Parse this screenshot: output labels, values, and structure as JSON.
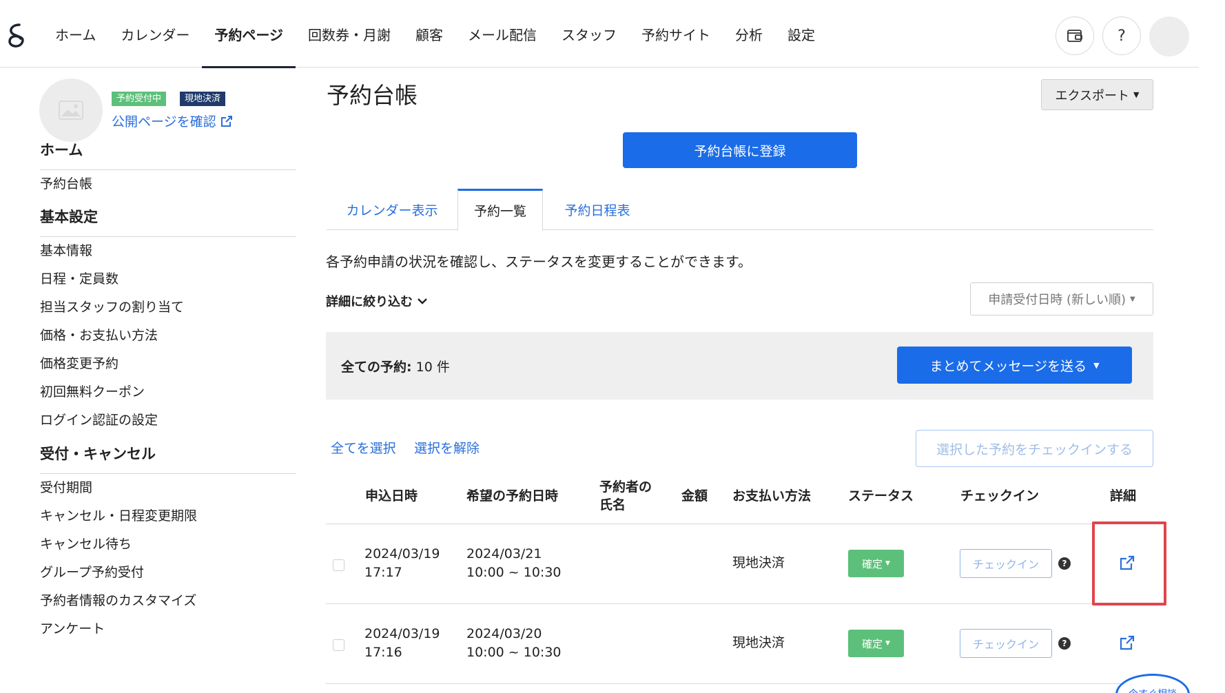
{
  "nav": {
    "items": [
      "ホーム",
      "カレンダー",
      "予約ページ",
      "回数券・月謝",
      "顧客",
      "メール配信",
      "スタッフ",
      "予約サイト",
      "分析",
      "設定"
    ],
    "active_index": 2,
    "help_label": "?"
  },
  "sidebar": {
    "badge_open": "予約受付中",
    "badge_pay": "現地決済",
    "public_link": "公開ページを確認",
    "sections": [
      {
        "title": "ホーム",
        "items": [
          "予約台帳"
        ]
      },
      {
        "title": "基本設定",
        "items": [
          "基本情報",
          "日程・定員数",
          "担当スタッフの割り当て",
          "価格・お支払い方法",
          "価格変更予約",
          "初回無料クーポン",
          "ログイン認証の設定"
        ]
      },
      {
        "title": "受付・キャンセル",
        "items": [
          "受付期間",
          "キャンセル・日程変更期限",
          "キャンセル待ち",
          "グループ予約受付",
          "予約者情報のカスタマイズ",
          "アンケート"
        ]
      }
    ]
  },
  "main": {
    "title": "予約台帳",
    "export_label": "エクスポート",
    "register_label": "予約台帳に登録",
    "tabs": [
      "カレンダー表示",
      "予約一覧",
      "予約日程表"
    ],
    "active_tab": 1,
    "description": "各予約申請の状況を確認し、ステータスを変更することができます。",
    "filter_label": "詳細に絞り込む",
    "sort_label": "申請受付日時 (新しい順)",
    "summary_label": "全ての予約:",
    "summary_count": "10 件",
    "bulk_message_label": "まとめてメッセージを送る",
    "select_all": "全てを選択",
    "deselect": "選択を解除",
    "checkin_selected": "選択した予約をチェックインする",
    "chat_label": "今すぐ相談"
  },
  "table": {
    "headers": {
      "applied": "申込日時",
      "desired": "希望の予約日時",
      "name_line1": "予約者の",
      "name_line2": "氏名",
      "amount": "金額",
      "payment": "お支払い方法",
      "status": "ステータス",
      "checkin": "チェックイン",
      "detail": "詳細"
    },
    "rows": [
      {
        "applied_date": "2024/03/19",
        "applied_time": "17:17",
        "desired_date": "2024/03/21",
        "desired_time": "10:00 ~ 10:30",
        "payment": "現地決済",
        "status": "確定",
        "checkin": "チェックイン"
      },
      {
        "applied_date": "2024/03/19",
        "applied_time": "17:16",
        "desired_date": "2024/03/20",
        "desired_time": "10:00 ~ 10:30",
        "payment": "現地決済",
        "status": "確定",
        "checkin": "チェックイン"
      }
    ]
  },
  "colors": {
    "primary": "#1a6ce8",
    "confirmed": "#5cc07a",
    "highlight": "#e0454d",
    "badge_navy": "#1f3a6b"
  }
}
